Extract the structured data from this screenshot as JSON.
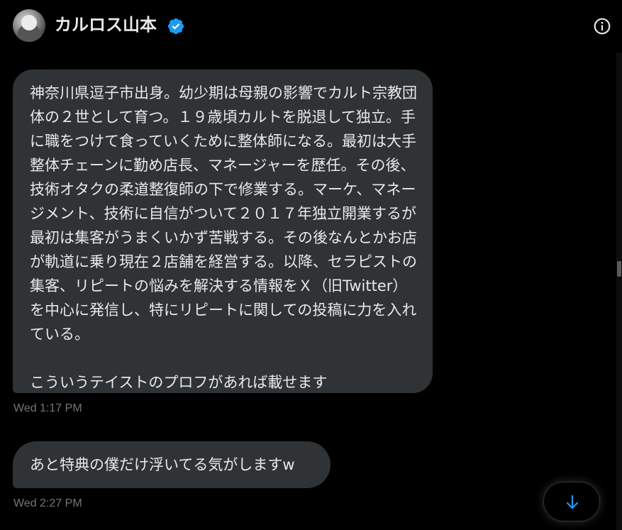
{
  "header": {
    "name": "カルロス山本",
    "verified_icon": "verified-badge-icon",
    "info_icon": "info-icon",
    "accent_color": "#1d9bf0"
  },
  "messages": [
    {
      "text": "神奈川県逗子市出身。幼少期は母親の影響でカルト宗教団体の２世として育つ。１９歳頃カルトを脱退して独立。手に職をつけて食っていくために整体師になる。最初は大手整体チェーンに勤め店長、マネージャーを歴任。その後、技術オタクの柔道整復師の下で修業する。マーケ、マネージメント、技術に自信がついて２０１７年独立開業するが最初は集客がうまくいかず苦戦する。その後なんとかお店が軌道に乗り現在２店舗を経営する。以降、セラピストの集客、リピートの悩みを解決する情報をＸ（旧Twitter）を中心に発信し、特にリピートに関しての投稿に力を入れている。\n\nこういうテイストのプロフがあれば載せます",
      "time": "Wed 1:17 PM"
    },
    {
      "text": "あと特典の僕だけ浮いてる気がしますw",
      "time": "Wed 2:27 PM"
    }
  ],
  "scroll_down_icon": "arrow-down-icon",
  "colors": {
    "background": "#000000",
    "bubble": "#2f3336",
    "text": "#e7e9ea",
    "timestamp": "#71767b"
  }
}
